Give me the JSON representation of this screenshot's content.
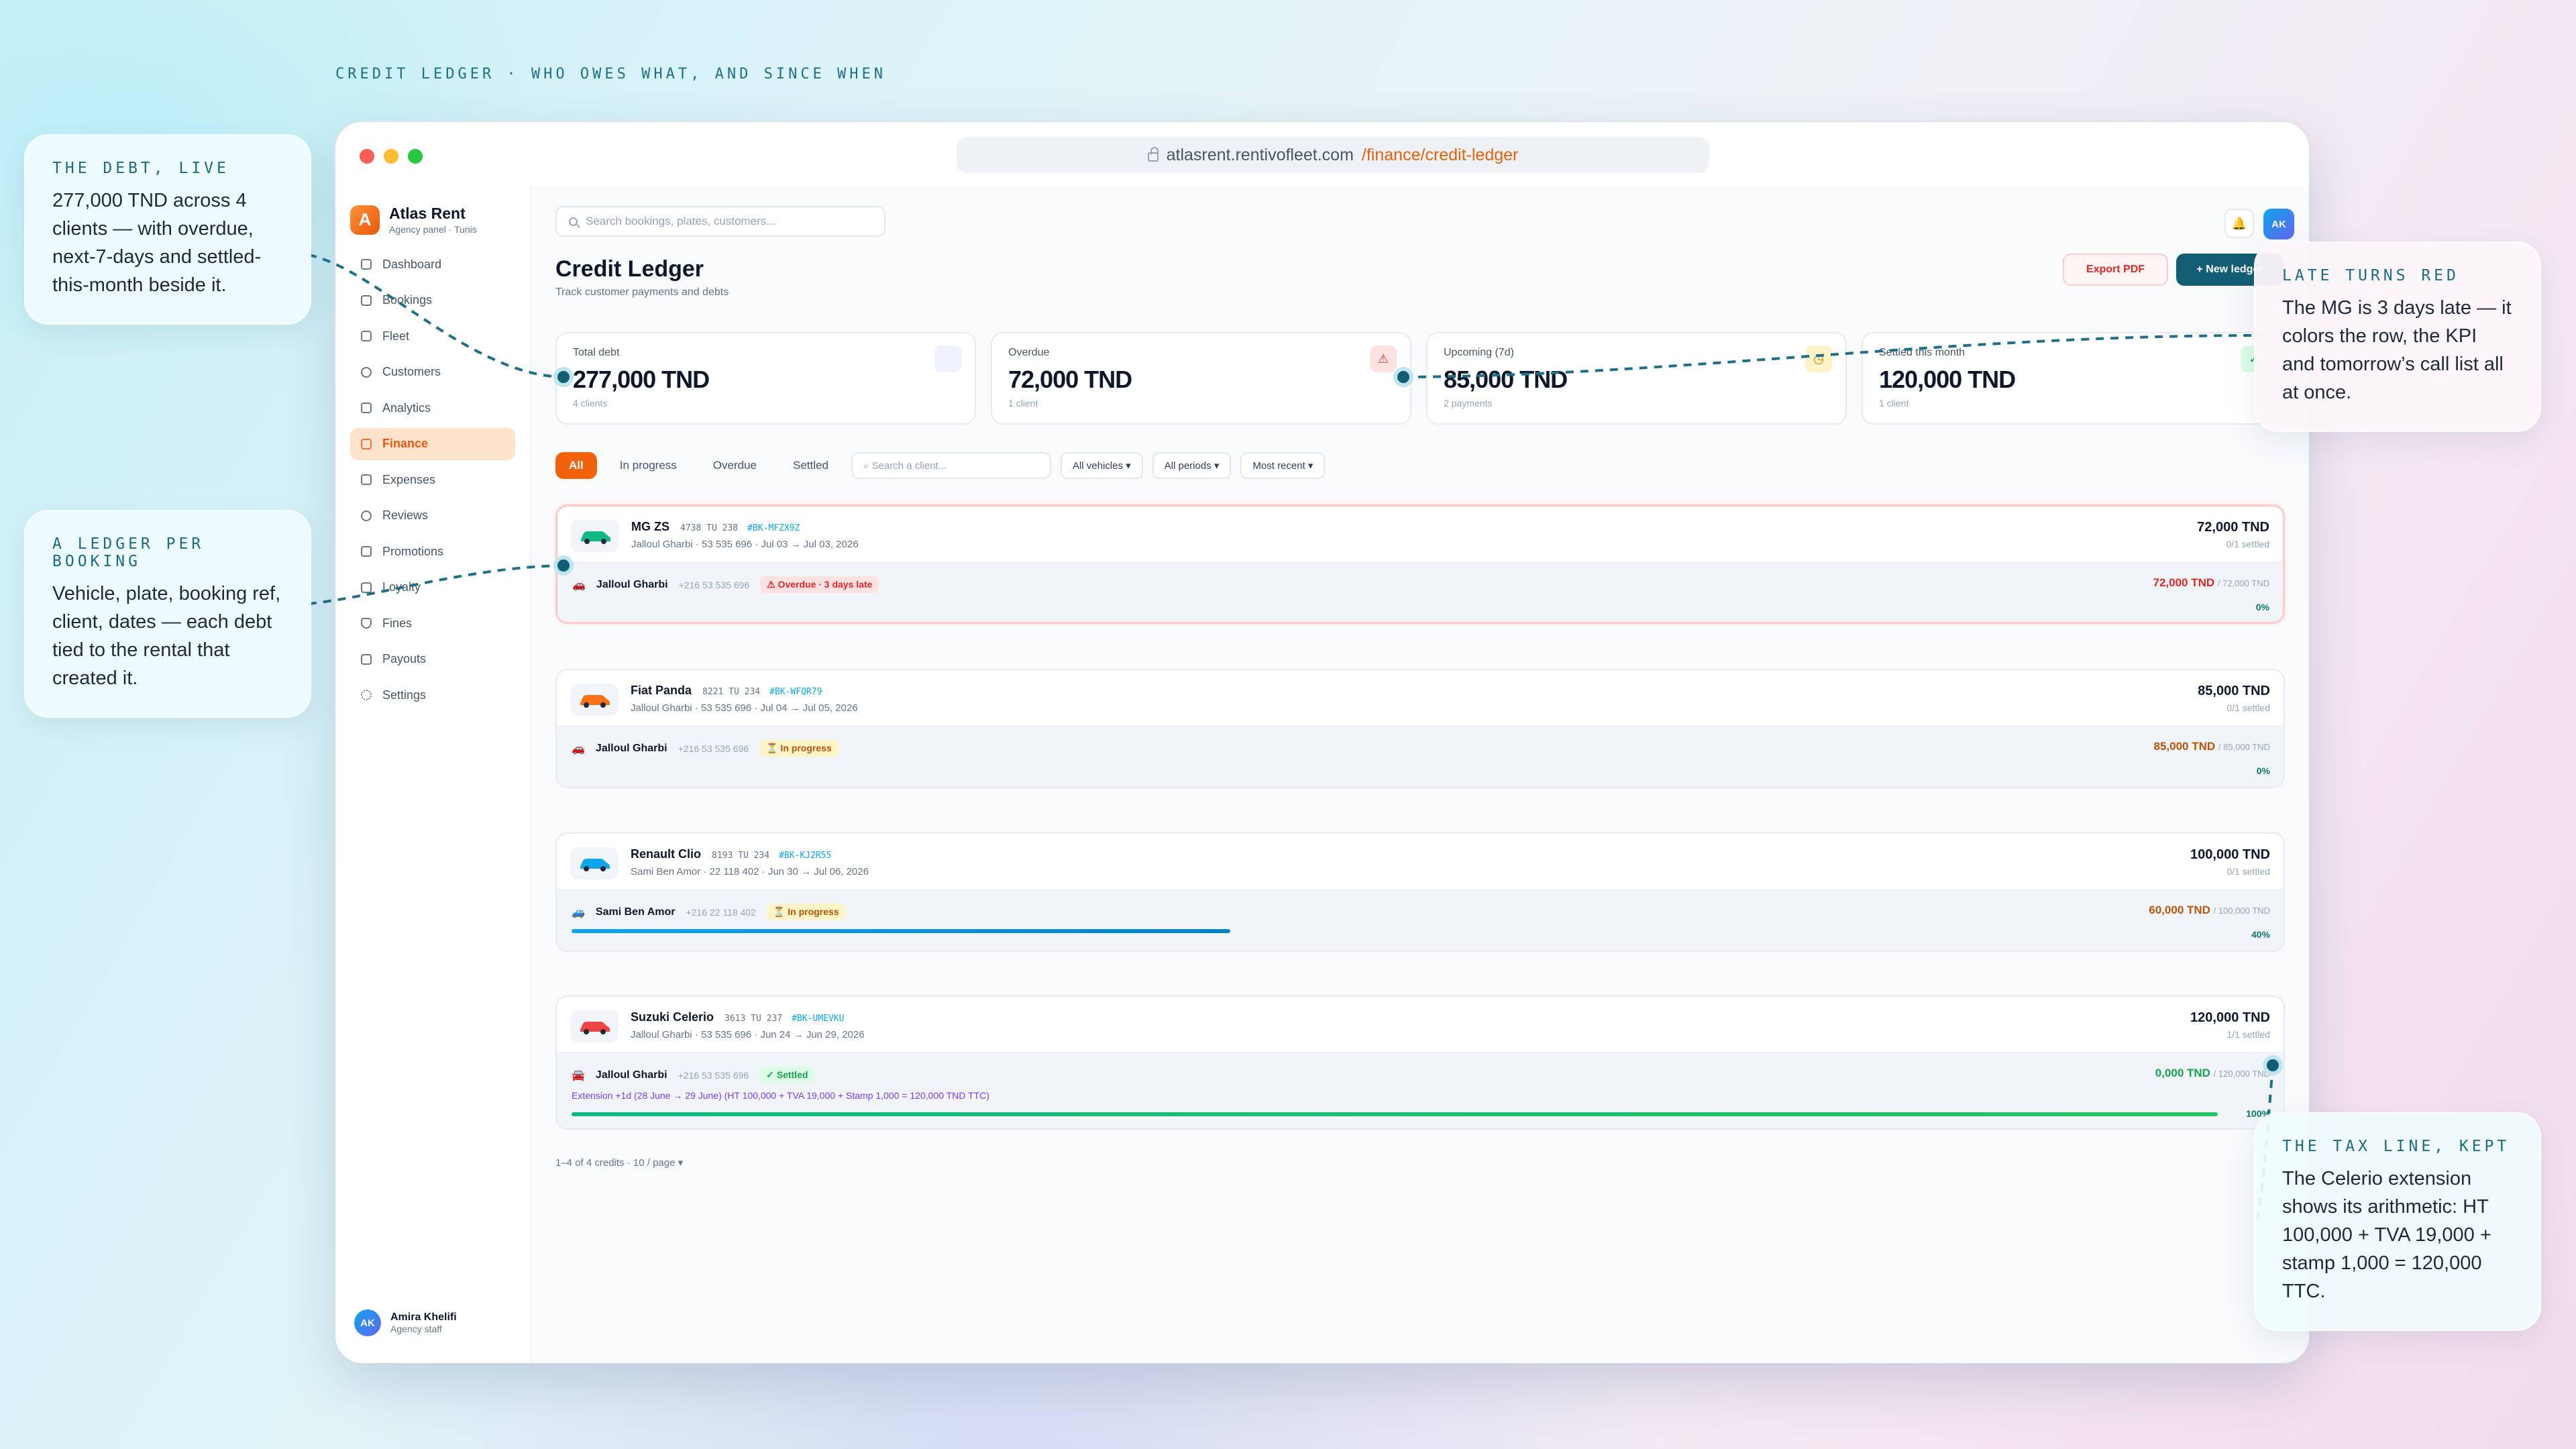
{
  "headline": "CREDIT LEDGER · WHO OWES WHAT, AND SINCE WHEN",
  "browser": {
    "url_host": "atlasrent.rentivofleet.com",
    "url_path": "/finance/credit-ledger"
  },
  "brand": {
    "name": "Atlas Rent",
    "sub": "Agency panel · Tunis",
    "logo": "A"
  },
  "nav": [
    {
      "label": "Dashboard"
    },
    {
      "label": "Bookings"
    },
    {
      "label": "Fleet"
    },
    {
      "label": "Customers"
    },
    {
      "label": "Analytics"
    },
    {
      "label": "Finance"
    },
    {
      "label": "Expenses"
    },
    {
      "label": "Reviews"
    },
    {
      "label": "Promotions"
    },
    {
      "label": "Loyalty"
    },
    {
      "label": "Fines"
    },
    {
      "label": "Payouts"
    },
    {
      "label": "Settings"
    }
  ],
  "user": {
    "initials": "AK",
    "name": "Amira Khelifi",
    "role": "Agency staff"
  },
  "search": {
    "placeholder": "Search bookings, plates, customers..."
  },
  "page": {
    "title": "Credit Ledger",
    "subtitle": "Track customer payments and debts",
    "export_label": "Export PDF",
    "new_label": "+ New ledger"
  },
  "kpis": [
    {
      "label": "Total debt",
      "value": "277,000 TND",
      "sub": "4 clients"
    },
    {
      "label": "Overdue",
      "value": "72,000 TND",
      "sub": "1 client"
    },
    {
      "label": "Upcoming (7d)",
      "value": "85,000 TND",
      "sub": "2 payments"
    },
    {
      "label": "Settled this month",
      "value": "120,000 TND",
      "sub": "1 client"
    }
  ],
  "filters": {
    "tabs": [
      "All",
      "In progress",
      "Overdue",
      "Settled"
    ],
    "search_placeholder": "Search a client...",
    "vehicles": "All vehicles ▾",
    "periods": "All periods ▾",
    "sort": "Most recent ▾"
  },
  "ledgers": [
    {
      "car": "MG ZS",
      "plate": "4738 TU 238",
      "ref": "#BK-MFZX9Z",
      "meta": "Jalloul Gharbi · 53 535 696 · Jul 03 → Jul 03, 2026",
      "amount": "72,000 TND",
      "settled": "0/1 settled",
      "client": "Jalloul Gharbi",
      "phone": "+216 53 535 696",
      "badge": "⚠ Overdue · 3 days late",
      "balance": "72,000 TND",
      "of": "/ 72,000 TND",
      "pct": "0%",
      "progress": 0,
      "car_color": "#10b981"
    },
    {
      "car": "Fiat Panda",
      "plate": "8221 TU 234",
      "ref": "#BK-WFQR79",
      "meta": "Jalloul Gharbi · 53 535 696 · Jul 04 → Jul 05, 2026",
      "amount": "85,000 TND",
      "settled": "0/1 settled",
      "client": "Jalloul Gharbi",
      "phone": "+216 53 535 696",
      "badge": "⏳ In progress",
      "balance": "85,000 TND",
      "of": "/ 85,000 TND",
      "pct": "0%",
      "progress": 0,
      "car_color": "#f97316"
    },
    {
      "car": "Renault Clio",
      "plate": "8193 TU 234",
      "ref": "#BK-KJ2R55",
      "meta": "Sami Ben Amor · 22 118 402 · Jun 30 → Jul 06, 2026",
      "amount": "100,000 TND",
      "settled": "0/1 settled",
      "client": "Sami Ben Amor",
      "phone": "+216 22 118 402",
      "badge": "⏳ In progress",
      "balance": "60,000 TND",
      "of": "/ 100,000 TND",
      "pct": "40%",
      "progress": 0.4,
      "car_color": "#0ea5e9"
    },
    {
      "car": "Suzuki Celerio",
      "plate": "3613 TU 237",
      "ref": "#BK-UMEVKU",
      "meta": "Jalloul Gharbi · 53 535 696 · Jun 24 → Jun 29, 2026",
      "amount": "120,000 TND",
      "settled": "1/1 settled",
      "client": "Jalloul Gharbi",
      "phone": "+216 53 535 696",
      "badge": "✓ Settled",
      "balance": "0,000 TND",
      "of": "/ 120,000 TND",
      "pct": "100%",
      "progress": 1,
      "car_color": "#ef4444",
      "note": "Extension +1d (28 June → 29 June) (HT 100,000 + TVA 19,000 + Stamp 1,000 = 120,000 TND TTC)"
    }
  ],
  "pager": "1–4 of 4 credits · 10 / page ▾",
  "callouts": {
    "debt": {
      "title": "THE DEBT, LIVE",
      "body": "277,000 TND across 4 clients — with overdue, next-7-days and settled-this-month beside it."
    },
    "ledger": {
      "title": "A LEDGER PER BOOKING",
      "body": "Vehicle, plate, booking ref, client, dates — each debt tied to the rental that created it."
    },
    "late": {
      "title": "LATE TURNS RED",
      "body": "The MG is 3 days late — it colors the row, the KPI and tomorrow’s call list all at once."
    },
    "tax": {
      "title": "THE TAX LINE, KEPT",
      "body": "The Celerio extension shows its arithmetic: HT 100,000 + TVA 19,000 + stamp 1,000 = 120,000 TTC."
    }
  }
}
